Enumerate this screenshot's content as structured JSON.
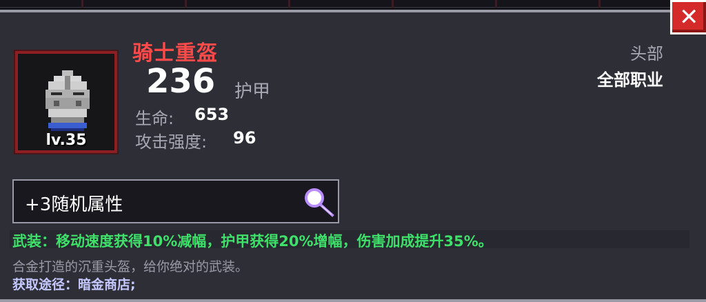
{
  "item": {
    "name": "骑士重盔",
    "level": "lv.35",
    "armor": "236",
    "armor_label": "护甲",
    "slot": "头部",
    "classes": "全部职业",
    "icon": "knight-helmet-icon",
    "stats": [
      {
        "label": "生命:",
        "value": "653"
      },
      {
        "label": "攻击强度:",
        "value": "96"
      }
    ]
  },
  "random_attributes": {
    "label": "+3随机属性",
    "icon": "magnifier-icon"
  },
  "effect": "武装：移动速度获得10%减幅，护甲获得20%增幅，伤害加成提升35%。",
  "description": "合金打造的沉重头盔，给你绝对的武装。",
  "source": "获取途径：暗金商店;",
  "close": {
    "glyph": "✕",
    "icon": "close-icon"
  },
  "colors": {
    "panel": "#2e2e37",
    "name": "#ff4a4a",
    "effect": "#3fe06a",
    "source": "#c4c8ff",
    "frame": "#8d1f22",
    "close": "#d42a2a"
  }
}
